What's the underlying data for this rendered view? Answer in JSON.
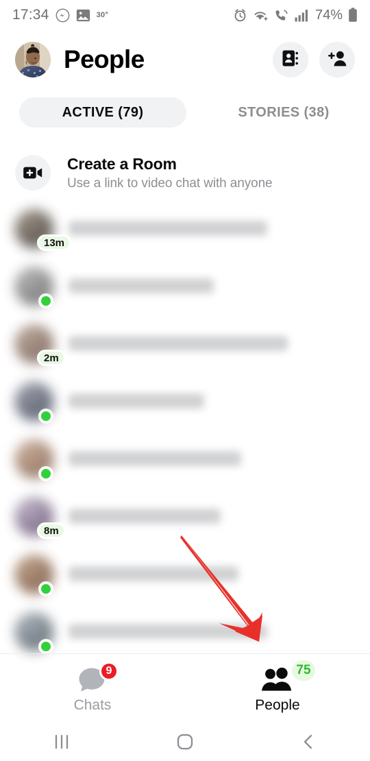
{
  "status_bar": {
    "time": "17:34",
    "temperature": "30°",
    "battery_percent": "74%",
    "icons": [
      "messenger-icon",
      "gallery-icon",
      "alarm-icon",
      "wifi-icon",
      "call-icon",
      "signal-icon",
      "battery-icon"
    ]
  },
  "header": {
    "title": "People",
    "avatar_name": "profile-avatar",
    "actions": [
      {
        "name": "contacts-book-button",
        "icon": "contact-book-icon"
      },
      {
        "name": "add-person-button",
        "icon": "add-person-icon"
      }
    ]
  },
  "tabs": [
    {
      "label": "ACTIVE (79)",
      "active": true,
      "name": "tab-active"
    },
    {
      "label": "STORIES (38)",
      "active": false,
      "name": "tab-stories"
    }
  ],
  "create_room": {
    "icon": "video-plus-icon",
    "title": "Create a Room",
    "subtitle": "Use a link to video chat with anyone"
  },
  "contacts": [
    {
      "name_blurred": true,
      "name_width": 290,
      "badge": "13m",
      "status": "away",
      "av_a": "#8e8275",
      "av_b": "#4a453f"
    },
    {
      "name_blurred": true,
      "name_width": 212,
      "badge": null,
      "status": "online",
      "av_a": "#a9a9a9",
      "av_b": "#6f6f6f"
    },
    {
      "name_blurred": true,
      "name_width": 320,
      "badge": "2m",
      "status": "away",
      "av_a": "#b09a8c",
      "av_b": "#7a6257"
    },
    {
      "name_blurred": true,
      "name_width": 198,
      "badge": null,
      "status": "online",
      "av_a": "#8b8c9a",
      "av_b": "#4e5565"
    },
    {
      "name_blurred": true,
      "name_width": 252,
      "badge": null,
      "status": "online",
      "av_a": "#c2a38e",
      "av_b": "#8a6a55"
    },
    {
      "name_blurred": true,
      "name_width": 222,
      "badge": "8m",
      "status": "away",
      "av_a": "#b6a8c0",
      "av_b": "#6d5c7a"
    },
    {
      "name_blurred": true,
      "name_width": 248,
      "badge": null,
      "status": "online",
      "av_a": "#b59378",
      "av_b": "#7c5a43"
    },
    {
      "name_blurred": true,
      "name_width": 290,
      "badge": null,
      "status": "online",
      "av_a": "#9aa3ad",
      "av_b": "#5d676f"
    }
  ],
  "bottom_nav": [
    {
      "label": "Chats",
      "badge": "9",
      "badge_type": "red",
      "icon": "chat-bubble-icon",
      "active": false,
      "name": "nav-chats"
    },
    {
      "label": "People",
      "badge": "75",
      "badge_type": "green",
      "icon": "people-icon",
      "active": true,
      "name": "nav-people"
    }
  ],
  "android_nav": [
    {
      "name": "recents-button",
      "icon": "recents-icon"
    },
    {
      "name": "home-button",
      "icon": "home-icon"
    },
    {
      "name": "back-button",
      "icon": "back-icon"
    }
  ],
  "annotation": {
    "type": "arrow",
    "color": "#e8302a",
    "points_to": "nav-people"
  },
  "colors": {
    "online_green": "#31d13b",
    "badge_bg_green": "#e9f8e4",
    "badge_red": "#ec1c24",
    "tab_pill_bg": "#f1f2f4",
    "muted_text": "#8d8f94",
    "arrow_red": "#e8302a"
  }
}
